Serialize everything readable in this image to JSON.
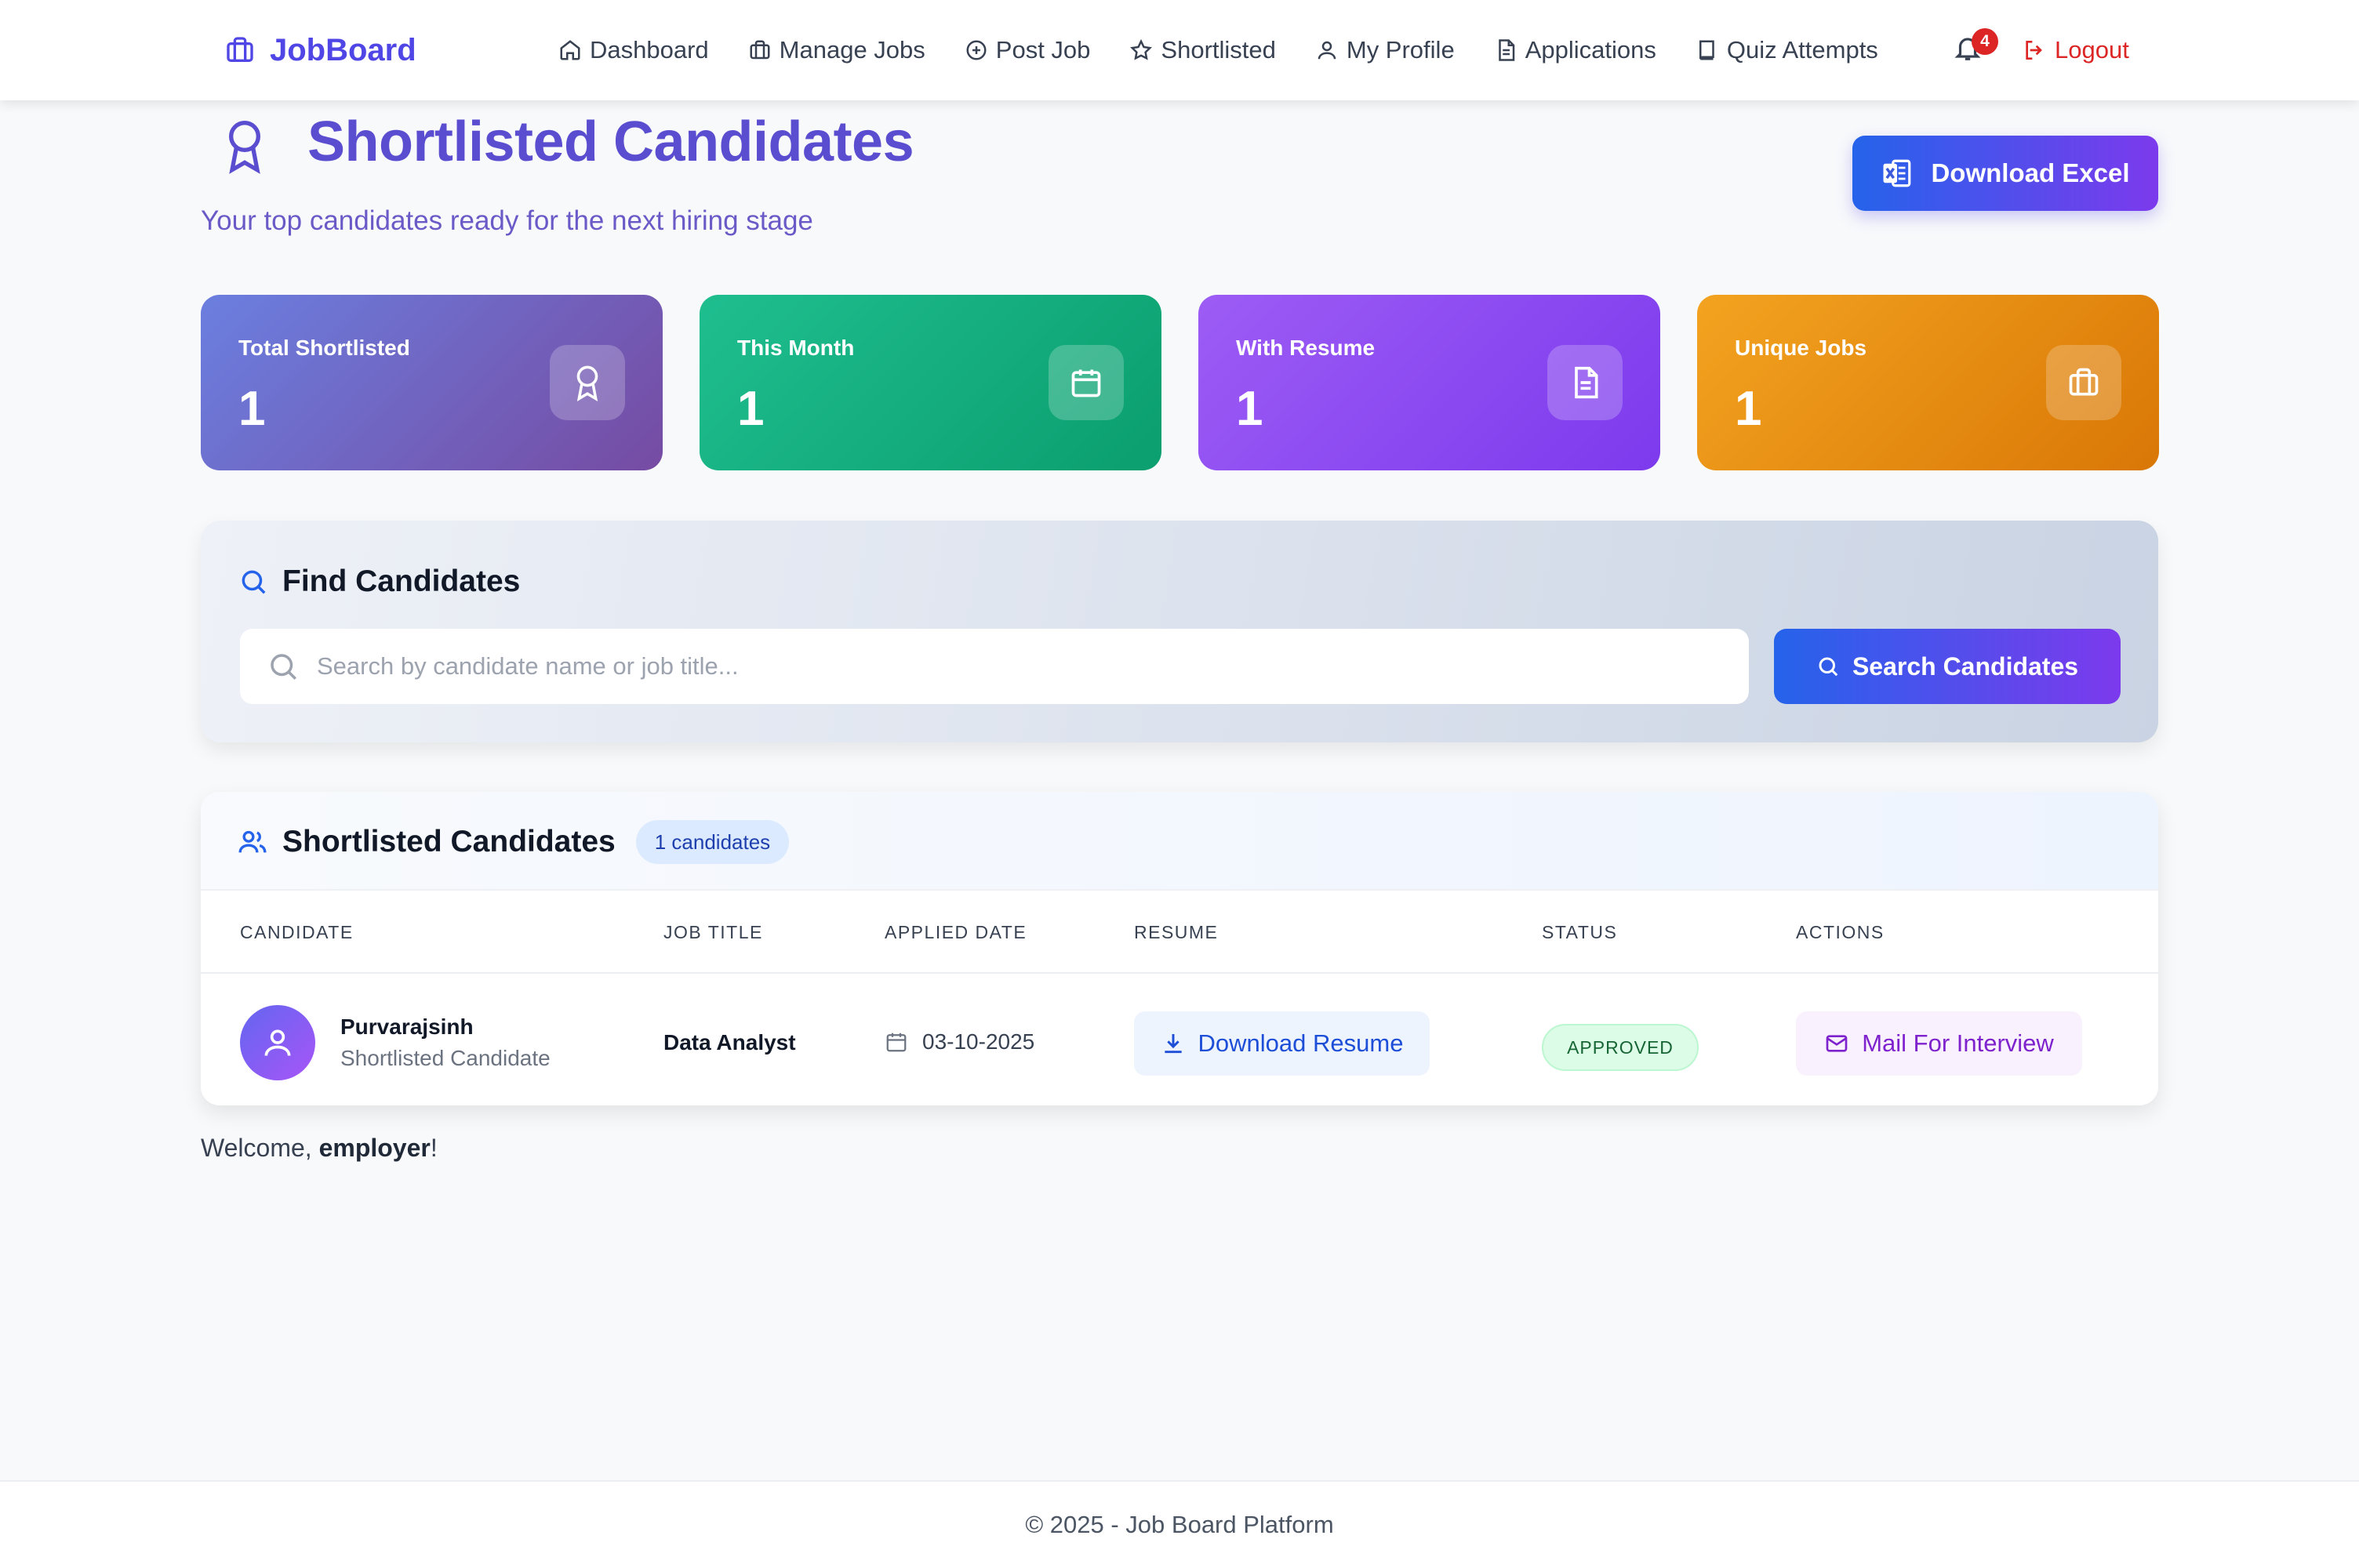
{
  "navbar": {
    "brand": "JobBoard",
    "links": [
      {
        "label": "Dashboard",
        "icon": "home-icon"
      },
      {
        "label": "Manage Jobs",
        "icon": "briefcase-icon"
      },
      {
        "label": "Post Job",
        "icon": "plus-circle-icon"
      },
      {
        "label": "Shortlisted",
        "icon": "star-icon"
      },
      {
        "label": "My Profile",
        "icon": "user-icon"
      },
      {
        "label": "Applications",
        "icon": "document-icon"
      },
      {
        "label": "Quiz Attempts",
        "icon": "book-icon"
      }
    ],
    "notification_count": "4",
    "logout_label": "Logout"
  },
  "header": {
    "title": "Shortlisted Candidates",
    "subtitle": "Your top candidates ready for the next hiring stage",
    "download_excel_label": "Download Excel"
  },
  "stats": [
    {
      "label": "Total Shortlisted",
      "value": "1",
      "icon": "award-icon"
    },
    {
      "label": "This Month",
      "value": "1",
      "icon": "calendar-icon"
    },
    {
      "label": "With Resume",
      "value": "1",
      "icon": "document-icon"
    },
    {
      "label": "Unique Jobs",
      "value": "1",
      "icon": "briefcase-icon"
    }
  ],
  "find": {
    "title": "Find Candidates",
    "search_placeholder": "Search by candidate name or job title...",
    "search_value": "",
    "search_button_label": "Search Candidates"
  },
  "table": {
    "title": "Shortlisted Candidates",
    "count_label": "1 candidates",
    "columns": [
      "CANDIDATE",
      "JOB TITLE",
      "APPLIED DATE",
      "RESUME",
      "STATUS",
      "ACTIONS"
    ],
    "rows": [
      {
        "name": "Purvarajsinh",
        "subtitle": "Shortlisted Candidate",
        "job_title": "Data Analyst",
        "applied_date": "03-10-2025",
        "resume_label": "Download Resume",
        "status": "APPROVED",
        "action_label": "Mail For Interview"
      }
    ]
  },
  "welcome": {
    "prefix": "Welcome, ",
    "user": "employer",
    "suffix": "!"
  },
  "footer": {
    "text": "© 2025 - Job Board Platform"
  },
  "colors": {
    "brand": "#4f46e5",
    "title": "#5b4dd0",
    "primary_gradient_start": "#2563eb",
    "primary_gradient_end": "#7c3aed",
    "card_total": "#7173d8",
    "card_month": "#10b981",
    "card_resume": "#8b5cf6",
    "card_jobs": "#f59e0b",
    "logout": "#dc2626",
    "status_approved": "#166534"
  }
}
